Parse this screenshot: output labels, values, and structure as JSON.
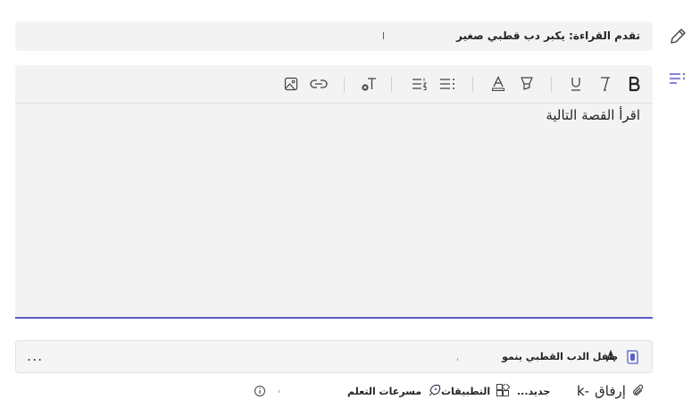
{
  "rail": {
    "edit_icon": "pencil-icon",
    "list_icon": "checklist-icon"
  },
  "title_field": {
    "value": "تقدم القراءة: يكبر دب قطبي صغير"
  },
  "toolbar": {
    "buttons": [
      "bold",
      "italic",
      "underline",
      "highlight",
      "font-color",
      "bullets",
      "numbering",
      "clear-format",
      "link",
      "image"
    ]
  },
  "editor": {
    "text": "اقرأ القصة التالية"
  },
  "attachment": {
    "name": "طفل الدب القطبي ينمو",
    "more": "..."
  },
  "bottom": {
    "attach_label": "إرفاق",
    "new_label": "جديد...",
    "apps_label": "التطبيقات",
    "accel_label": "مسرعات التعلم"
  },
  "colors": {
    "accent": "#5b5fc7",
    "field_bg": "#f3f3f3"
  }
}
